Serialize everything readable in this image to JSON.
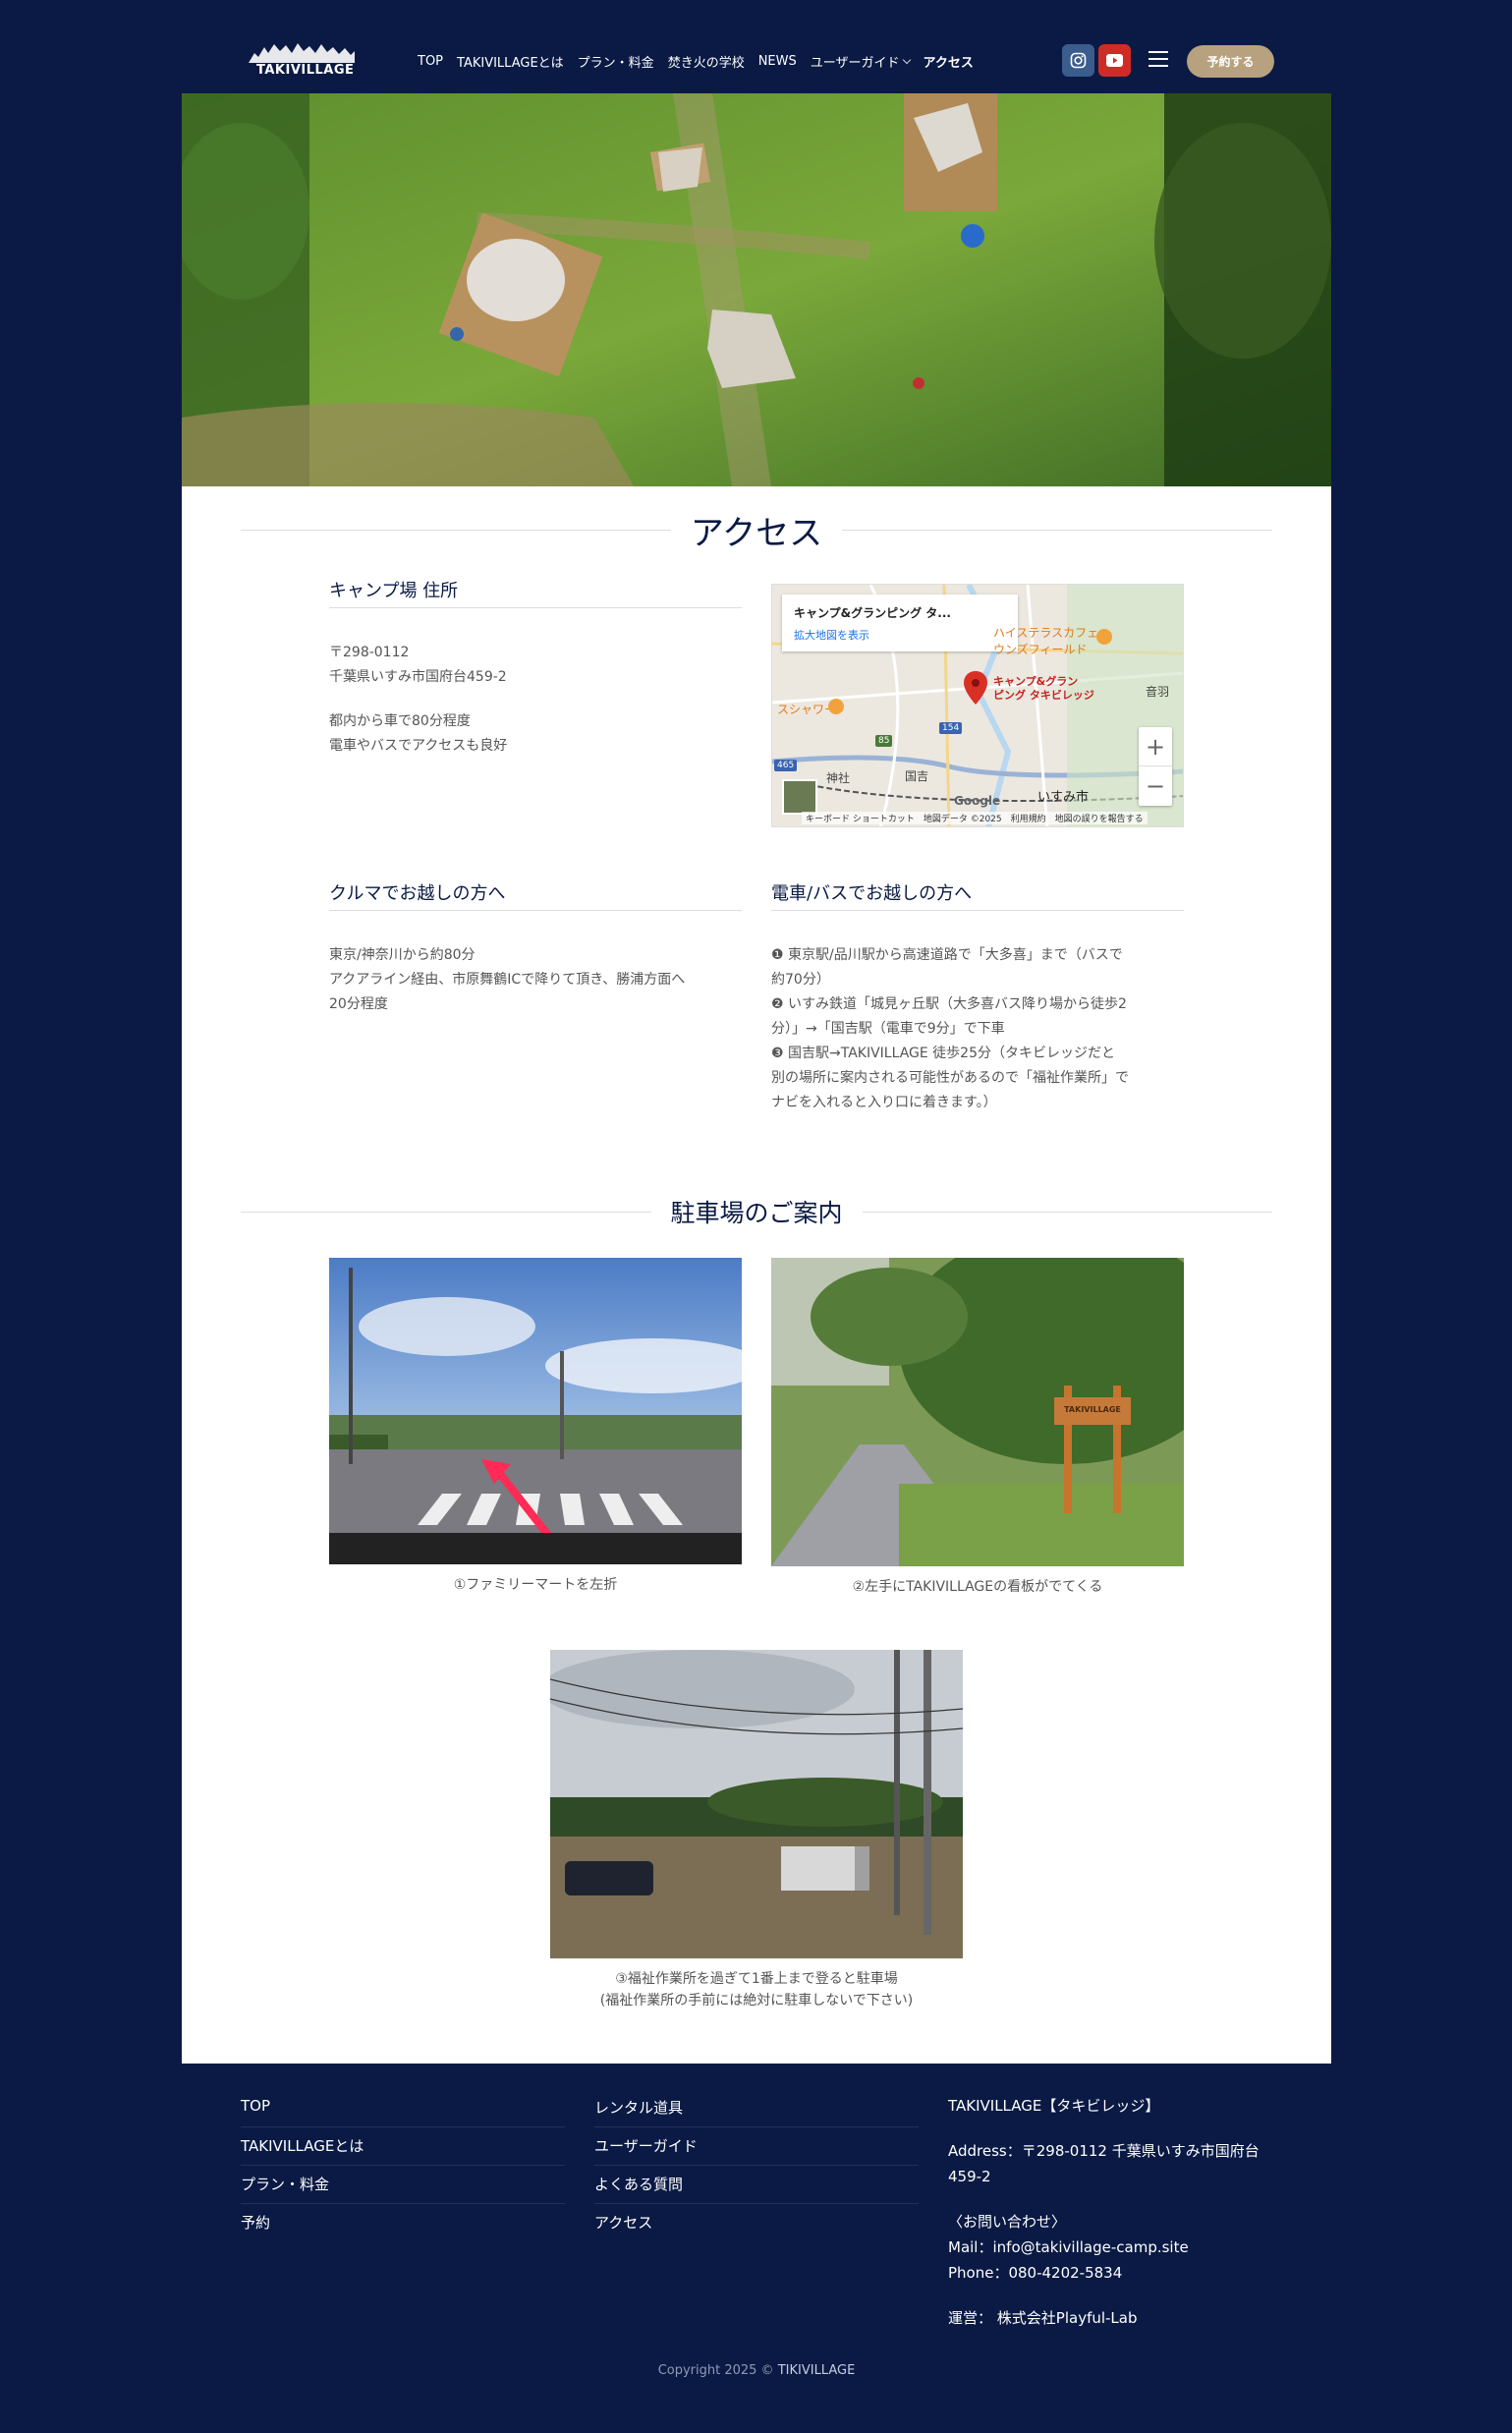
{
  "header": {
    "logo_text": "TAKIVILLAGE",
    "nav": [
      "TOP",
      "TAKIVILLAGEとは",
      "プラン・料金",
      "焚き火の学校",
      "NEWS",
      "ユーザーガイド",
      "アクセス"
    ],
    "reserve_label": "予約する"
  },
  "access": {
    "title": "アクセス",
    "address_heading": "キャンプ場 住所",
    "address_line1": "〒298-0112",
    "address_line2": "千葉県いすみ市国府台459-2",
    "note_line1": "都内から車で80分程度",
    "note_line2": "電車やバスでアクセスも良好",
    "car_heading": "クルマでお越しの方へ",
    "car_line1": "東京/神奈川から約80分",
    "car_line2": "アクアライン経由、市原舞鶴ICで降りて頂き、勝浦方面へ",
    "car_line3": "20分程度",
    "train_heading": "電車/バスでお越しの方へ",
    "train_line1": "❶ 東京駅/品川駅から高速道路で「大多喜」まで（バスで",
    "train_line2": "約70分）",
    "train_line3": "❷ いすみ鉄道「城見ヶ丘駅（大多喜バス降り場から徒歩2",
    "train_line4": "分）」→「国吉駅（電車で9分」で下車",
    "train_line5": "❸ 国吉駅→TAKIVILLAGE 徒歩25分（タキビレッジだと",
    "train_line6": "別の場所に案内される可能性があるので「福祉作業所」で",
    "train_line7": "ナビを入れると入り口に着きます。）"
  },
  "map": {
    "card_title": "キャンプ&グランピング タ...",
    "card_link": "拡大地図を表示",
    "pin_label_1": "キャンプ&グラン",
    "pin_label_2": "ピング タキビレッジ",
    "label_cafe_1": "ハイステラスカフェ",
    "label_cafe_2": "ウンズフィールド",
    "label_shower": "スシャワー",
    "label_city": "いすみ市",
    "label_kuniyoshi": "国吉",
    "label_shrine": "神社",
    "label_otowa": "音羽",
    "route_85": "85",
    "route_154": "154",
    "route_465": "465",
    "google": "Google",
    "footer_text": "キーボード ショートカット　地図データ ©2025　利用規約　地図の誤りを報告する",
    "zoom_in": "+",
    "zoom_out": "−"
  },
  "parking": {
    "title": "駐車場のご案内",
    "caption1": "①ファミリーマートを左折",
    "caption2": "②左手にTAKIVILLAGEの看板がでてくる",
    "caption3_line1": "③福祉作業所を過ぎて1番上まで登ると駐車場",
    "caption3_line2": "(福祉作業所の手前には絶対に駐車しないで下さい)",
    "sign_text": "TAKIVILLAGE"
  },
  "footer": {
    "col1": [
      "TOP",
      "TAKIVILLAGEとは",
      "プラン・料金",
      "予約"
    ],
    "col2": [
      "レンタル道具",
      "ユーザーガイド",
      "よくある質問",
      "アクセス"
    ],
    "company": "TAKIVILLAGE【タキビレッジ】",
    "address_label": "Address：",
    "address": "〒298-0112 千葉県いすみ市国府台",
    "address2": "459-2",
    "contact_heading": "〈お問い合わせ〉",
    "mail_label": "Mail：",
    "mail": "info@takivillage-camp.site",
    "phone_label": "Phone：",
    "phone": "080-4202-5834",
    "operator_label": "運営：",
    "operator": " 株式会社Playful-Lab",
    "copyright": "Copyright 2025 © ",
    "copyright_brand": "TIKIVILLAGE"
  }
}
